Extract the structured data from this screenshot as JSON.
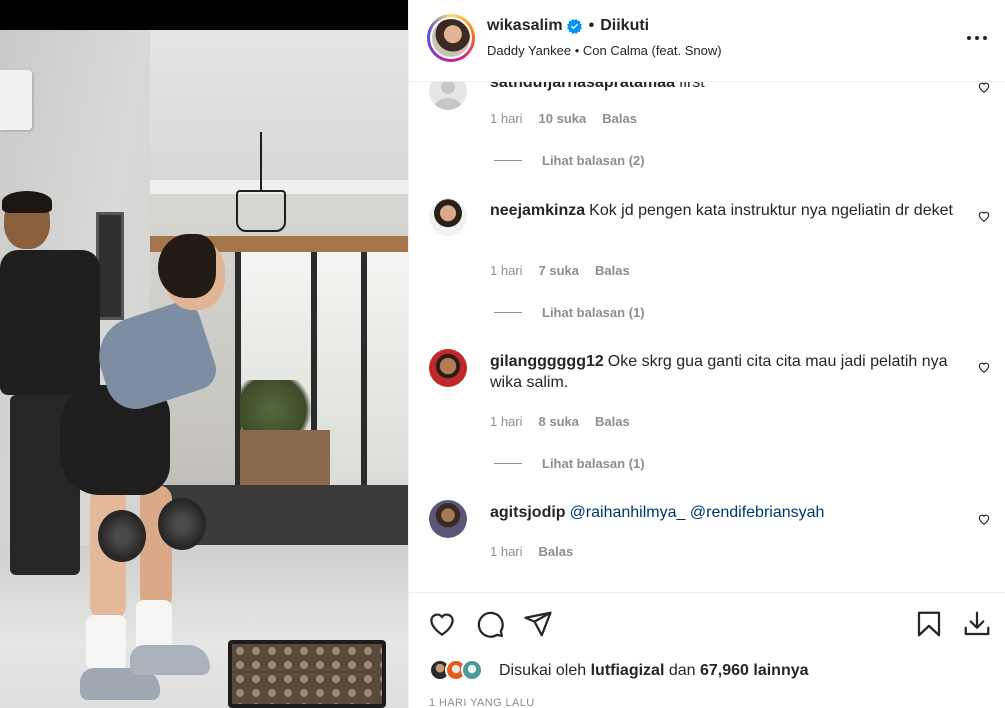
{
  "header": {
    "username": "wikasalim",
    "separator": "•",
    "follow_status": "Diikuti",
    "audio": "Daddy Yankee • Con Calma (feat. Snow)"
  },
  "comments": [
    {
      "username": "sathdufjarhasapratamaa",
      "text": "first",
      "time": "1 hari",
      "likes": "10 suka",
      "reply": "Balas",
      "view_replies": "Lihat balasan (2)"
    },
    {
      "username": "neejamkinza",
      "text": "Kok jd pengen kata instruktur nya ngeliatin dr deket",
      "time": "1 hari",
      "likes": "7 suka",
      "reply": "Balas",
      "view_replies": "Lihat balasan (1)"
    },
    {
      "username": "gilangggggg12",
      "text": "Oke skrg gua ganti cita cita mau jadi pelatih nya wika salim.",
      "time": "1 hari",
      "likes": "8 suka",
      "reply": "Balas",
      "view_replies": "Lihat balasan (1)"
    },
    {
      "username": "agitsjodip",
      "mention1": "@raihanhilmya_",
      "mention2": "@rendifebriansyah",
      "time": "1 hari",
      "reply": "Balas"
    }
  ],
  "likes": {
    "prefix": "Disukai oleh",
    "user": "lutfiagizal",
    "connector": "dan",
    "count": "67,960 lainnya"
  },
  "timestamp": "1 HARI YANG LALU",
  "colors": {
    "text": "#262626",
    "secondary": "#8e8e8e",
    "mention": "#00376b",
    "verified": "#0095f6"
  },
  "icons": [
    "verified-badge-icon",
    "more-options-icon",
    "heart-icon",
    "comment-icon",
    "share-icon",
    "bookmark-icon",
    "download-icon"
  ]
}
